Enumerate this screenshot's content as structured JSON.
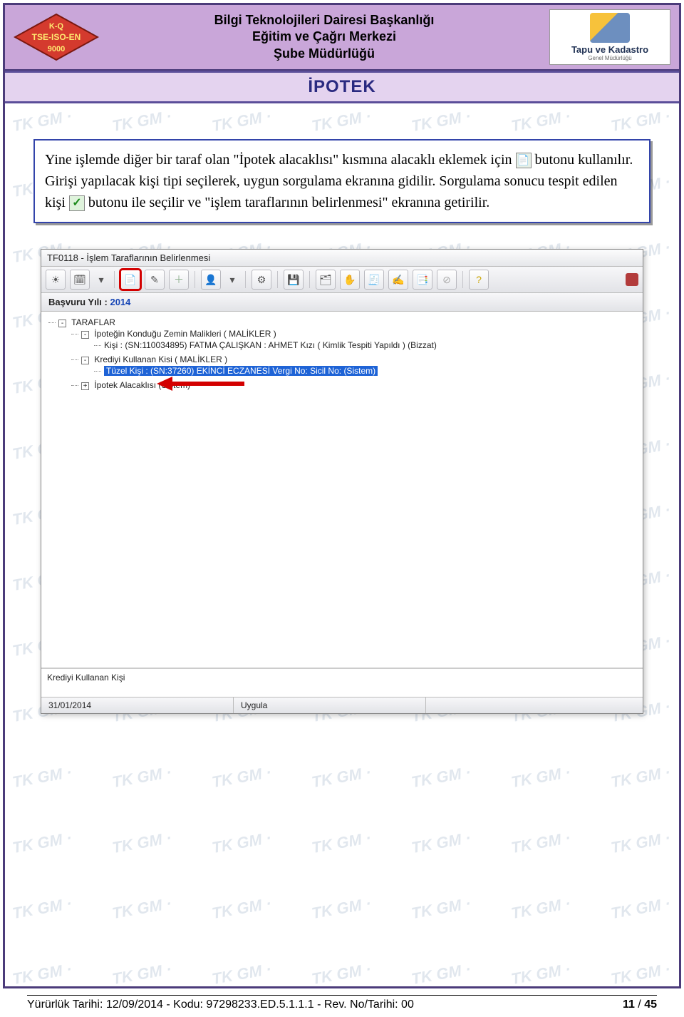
{
  "header": {
    "left_logo": {
      "top": "K-Q",
      "mid": "TSE-ISO-EN",
      "bot": "9000"
    },
    "lines": [
      "Bilgi Teknolojileri Dairesi Başkanlığı",
      "Eğitim ve Çağrı Merkezi",
      "Şube Müdürlüğü"
    ],
    "right_logo": {
      "main": "Tapu ve Kadastro",
      "sub": "Genel Müdürlüğü"
    }
  },
  "doc_title": "İPOTEK",
  "watermark": "TK GM",
  "instruction": {
    "part1": "Yine işlemde diğer bir taraf olan \"İpotek alacaklısı\" kısmına alacaklı eklemek için ",
    "part2": " butonu kullanılır. Girişi yapılacak kişi tipi seçilerek, uygun sorgulama ekranına gidilir. Sorgulama sonucu tespit edilen kişi ",
    "part3": " butonu ile seçilir ve \"işlem taraflarının belirlenmesi\" ekranına getirilir."
  },
  "app": {
    "title": "TF0118 - İşlem Taraflarının Belirlenmesi",
    "year_label": "Başvuru Yılı :",
    "year_value": "2014",
    "tree": {
      "root": "TARAFLAR",
      "n1": "İpoteğin Konduğu Zemin Malikleri ( MALİKLER )",
      "n1a": "Kişi : (SN:110034895) FATMA ÇALIŞKAN : AHMET Kızı ( Kimlik Tespiti Yapıldı ) (Bizzat)",
      "n2": "Krediyi Kullanan Kisi ( MALİKLER )",
      "n2a": "Tüzel Kişi : (SN:37260) EKİNCİ ECZANESİ Vergi No: Sicil No: (Sistem)",
      "n3": "İpotek Alacaklısı (Sistem)"
    },
    "bottom_info": "Krediyi Kullanan Kişi",
    "status_date": "31/01/2014",
    "status_action": "Uygula"
  },
  "footer": {
    "left": "Yürürlük Tarihi:  12/09/2014  -  Kodu:  97298233.ED.5.1.1.1  -  Rev. No/Tarihi: 00",
    "page_current": "11",
    "page_sep": " / ",
    "page_total": "45"
  }
}
